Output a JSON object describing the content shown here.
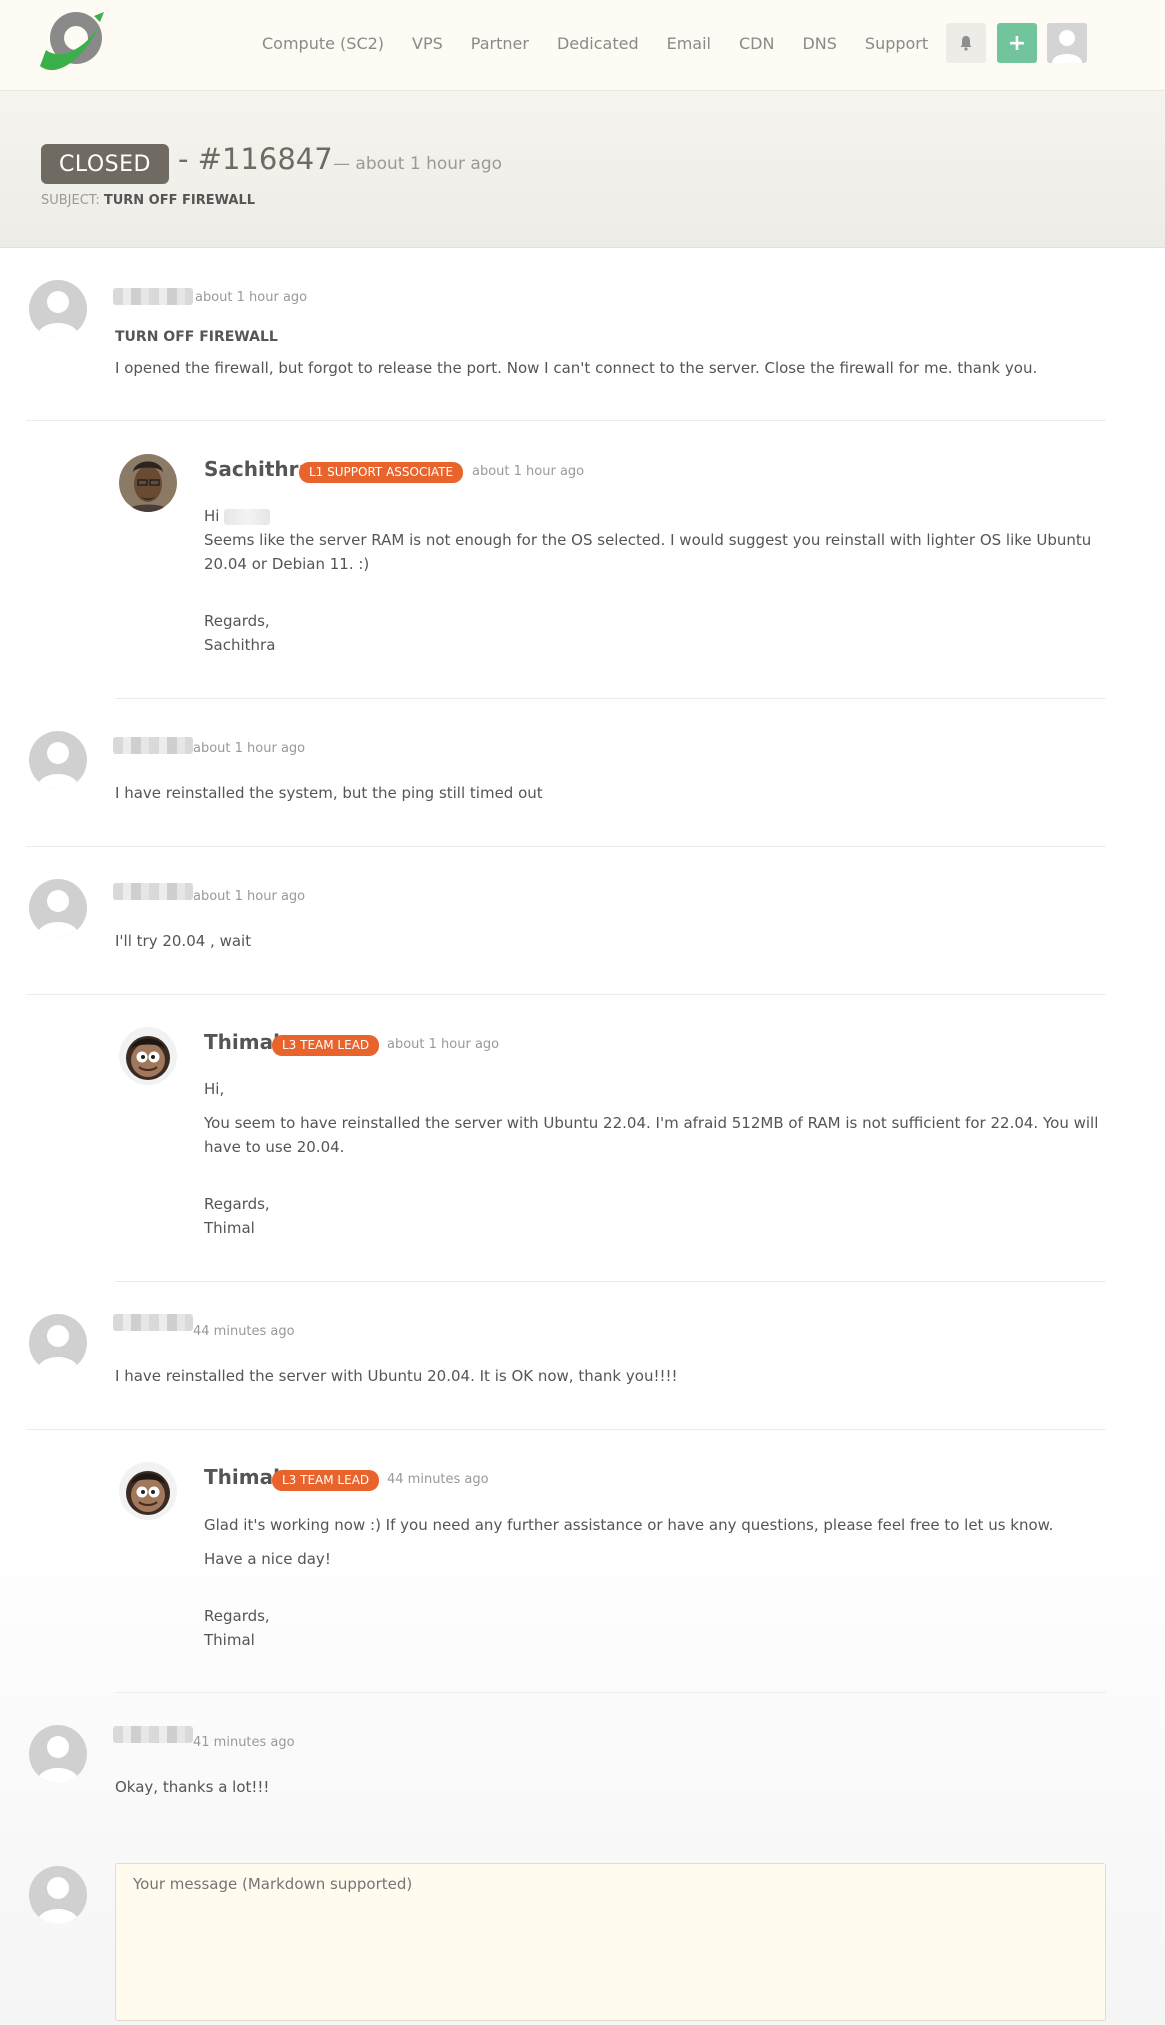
{
  "nav": {
    "links": [
      "Compute (SC2)",
      "VPS",
      "Partner",
      "Dedicated",
      "Email",
      "CDN",
      "DNS",
      "Support"
    ],
    "plus_label": "+"
  },
  "ticket": {
    "status": "CLOSED",
    "number": "- #116847",
    "age": "— about 1 hour ago",
    "subject_label": "SUBJECT:",
    "subject": "TURN OFF FIREWALL"
  },
  "messages": [
    {
      "time": "about 1 hour ago",
      "title": "TURN OFF FIREWALL",
      "text": "I opened the firewall, but forgot to release the port. Now I can't connect to the server. Close the firewall for me. thank you."
    },
    {
      "name": "Sachithra",
      "role": "L1 SUPPORT ASSOCIATE",
      "time": "about 1 hour ago",
      "greeting": "Hi",
      "text": "Seems like the server RAM is not enough for the OS selected. I would suggest you reinstall with lighter OS like Ubuntu 20.04 or Debian 11. :)",
      "regards": "Regards,",
      "signature": "Sachithra"
    },
    {
      "time": "about 1 hour ago",
      "text": "I have reinstalled the system, but the ping still timed out"
    },
    {
      "time": "about 1 hour ago",
      "text": "I'll try 20.04 ,  wait"
    },
    {
      "name": "Thimal",
      "role": "L3 TEAM LEAD",
      "time": "about 1 hour ago",
      "greeting": "Hi,",
      "text": "You seem to have reinstalled the server with Ubuntu 22.04. I'm afraid 512MB of RAM is not sufficient for 22.04. You will have to use 20.04.",
      "regards": "Regards,",
      "signature": "Thimal"
    },
    {
      "time": "44 minutes ago",
      "text": "I have reinstalled the server with Ubuntu 20.04. It is OK now, thank you!!!!"
    },
    {
      "name": "Thimal",
      "role": "L3 TEAM LEAD",
      "time": "44 minutes ago",
      "text": "Glad it's working now :) If you need any further assistance or have any questions, please feel free to let us know.",
      "text2": "Have a nice day!",
      "regards": "Regards,",
      "signature": "Thimal"
    },
    {
      "time": "41 minutes ago",
      "text": "Okay, thanks a lot!!!"
    }
  ],
  "reply": {
    "placeholder": "Your message (Markdown supported)"
  },
  "colors": {
    "accent_badge": "#e8642c",
    "closed_badge": "#6f6a62",
    "plus_button": "#72c49c"
  }
}
